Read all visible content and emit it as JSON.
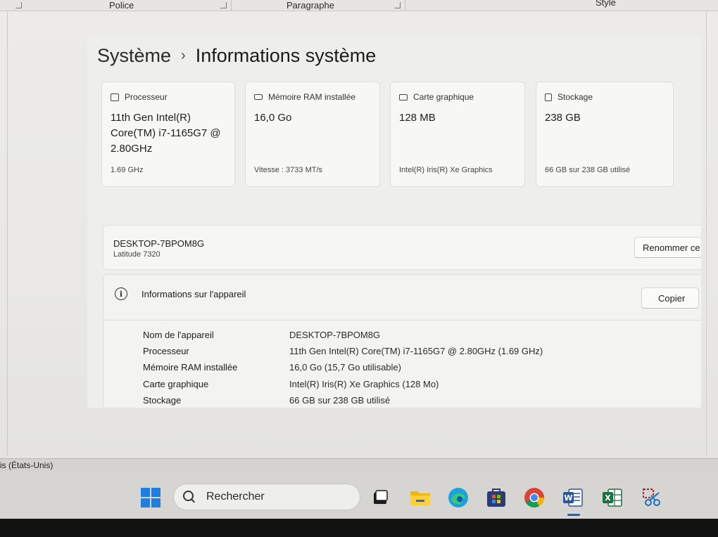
{
  "ribbon": {
    "groups": [
      "Police",
      "Paragraphe",
      "Style"
    ]
  },
  "settings": {
    "breadcrumb_parent": "Système",
    "breadcrumb_chevron": "›",
    "breadcrumb_current": "Informations système",
    "cards": [
      {
        "label": "Processeur",
        "value": "11th Gen Intel(R) Core(TM) i7-1165G7 @ 2.80GHz",
        "sub": "1.69 GHz",
        "icon": "cpu-icon"
      },
      {
        "label": "Mémoire RAM installée",
        "value": "16,0 Go",
        "sub": "Vitesse : 3733 MT/s",
        "icon": "ram-icon"
      },
      {
        "label": "Carte graphique",
        "value": "128 MB",
        "sub": "Intel(R) Iris(R) Xe Graphics",
        "icon": "gpu-icon"
      },
      {
        "label": "Stockage",
        "value": "238 GB",
        "sub": "66 GB sur 238 GB utilisé",
        "icon": "storage-icon"
      }
    ],
    "device_name": "DESKTOP-7BPOM8G",
    "device_model": "Latitude 7320",
    "rename_label": "Renommer ce",
    "device_info": {
      "title": "Informations sur l'appareil",
      "copy_label": "Copier",
      "rows": [
        {
          "k": "Nom de l'appareil",
          "v": "DESKTOP-7BPOM8G"
        },
        {
          "k": "Processeur",
          "v": "11th Gen Intel(R) Core(TM) i7-1165G7 @ 2.80GHz (1.69 GHz)"
        },
        {
          "k": "Mémoire RAM installée",
          "v": "16,0 Go (15,7 Go utilisable)"
        },
        {
          "k": "Carte graphique",
          "v": "Intel(R) Iris(R) Xe Graphics (128 Mo)"
        },
        {
          "k": "Stockage",
          "v": "66 GB sur 238 GB utilisé"
        }
      ]
    }
  },
  "statusbar": {
    "language": "is (États-Unis)"
  },
  "taskbar": {
    "search_placeholder": "Rechercher",
    "icons": [
      "windows-start-icon",
      "task-view-icon",
      "file-explorer-icon",
      "edge-icon",
      "store-icon",
      "chrome-icon",
      "word-icon",
      "excel-icon",
      "snipping-tool-icon"
    ],
    "active": "word-icon",
    "accent": "#1f5fbf"
  }
}
